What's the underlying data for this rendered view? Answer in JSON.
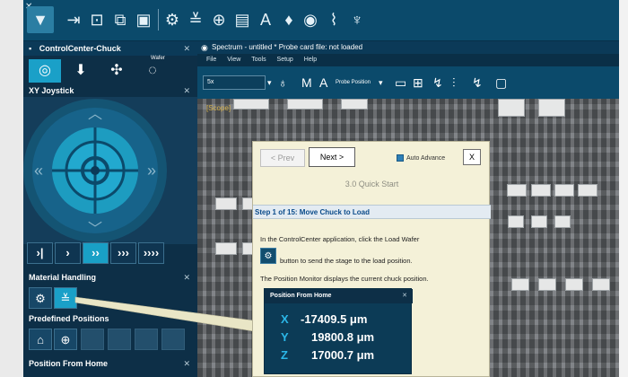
{
  "left_panel": {
    "title": "ControlCenter-Chuck",
    "tabs": [
      {
        "icon": "wafer-target-icon",
        "selected": true
      },
      {
        "icon": "probe-icon",
        "selected": false
      },
      {
        "icon": "fan-icon",
        "selected": false
      },
      {
        "icon": "wafer-icon",
        "label": "Wafer",
        "selected": false
      }
    ],
    "joystick_header": "XY Joystick",
    "joystick_buttons": [
      "›|",
      "›",
      "››",
      "›››",
      "››››"
    ],
    "material_handling_header": "Material Handling",
    "predefined_positions_header": "Predefined Positions",
    "position_from_home_header": "Position From Home"
  },
  "spectrum": {
    "title": "Spectrum - untitled * Probe card file: not loaded",
    "menu": [
      "File",
      "View",
      "Tools",
      "Setup",
      "Help"
    ],
    "zoom": "5x",
    "probe_position": "Probe Position",
    "scope_label": "[Scope]"
  },
  "quickstart": {
    "prev_label": "< Prev",
    "next_label": "Next >",
    "auto_advance_label": "Auto Advance",
    "auto_advance_checked": true,
    "close_label": "X",
    "title": "3.0 Quick Start",
    "step": "Step 1 of 15: Move Chuck to Load",
    "text1": "In the ControlCenter application, click the Load Wafer",
    "text2": "button to send the stage to the load position.",
    "text3": "The Position Monitor displays the current chuck position."
  },
  "position_window": {
    "title": "Position From Home",
    "rows": [
      {
        "axis": "X",
        "value": "-17409.5 μm"
      },
      {
        "axis": "Y",
        "value": "19800.8 μm"
      },
      {
        "axis": "Z",
        "value": "17000.7 μm"
      }
    ]
  },
  "colors": {
    "accent": "#1aa0c8",
    "app_bg": "#0c3f5c",
    "dialog_bg": "#f4f1d8",
    "axis_label": "#2bb7e8"
  }
}
